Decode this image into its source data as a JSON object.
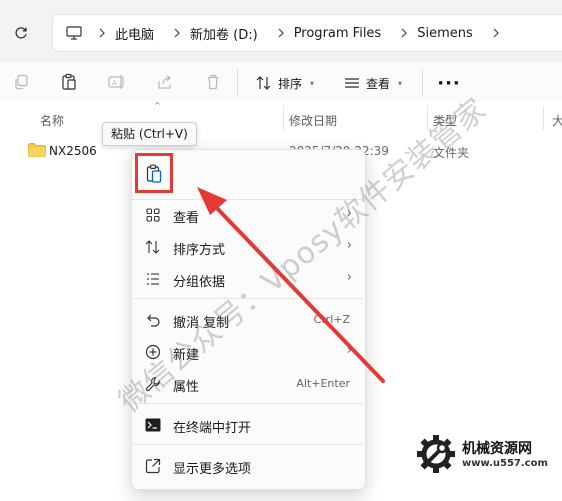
{
  "breadcrumb": [
    "此电脑",
    "新加卷 (D:)",
    "Program Files",
    "Siemens"
  ],
  "toolbar": {
    "sort_label": "排序",
    "view_label": "查看",
    "more_label": "···"
  },
  "columns": {
    "name": "名称",
    "date": "修改日期",
    "type": "类型",
    "size": "大"
  },
  "rows": [
    {
      "name": "NX2506",
      "date": "2025/7/29 22:39",
      "type": "文件夹"
    }
  ],
  "tooltip": "粘贴 (Ctrl+V)",
  "context_menu": {
    "items": [
      {
        "label": "查看",
        "icon": "grid-icon",
        "submenu": true
      },
      {
        "label": "排序方式",
        "icon": "sort-icon",
        "submenu": true
      },
      {
        "label": "分组依据",
        "icon": "group-icon",
        "submenu": true
      },
      {
        "label": "撤消 复制",
        "icon": "undo-icon",
        "shortcut": "Ctrl+Z"
      },
      {
        "label": "新建",
        "icon": "plus-circle-icon",
        "submenu": true
      },
      {
        "label": "属性",
        "icon": "wrench-icon",
        "shortcut": "Alt+Enter"
      },
      {
        "label": "在终端中打开",
        "icon": "terminal-icon"
      },
      {
        "label": "显示更多选项",
        "icon": "open-external-icon"
      }
    ]
  },
  "watermark": "微信公众号：Vposy软件安装管家",
  "logo": {
    "title": "机械资源网",
    "url": "www.u557.com"
  },
  "colors": {
    "highlight": "#e53935",
    "accent": "#0067c0",
    "folder": "#f4c542"
  }
}
